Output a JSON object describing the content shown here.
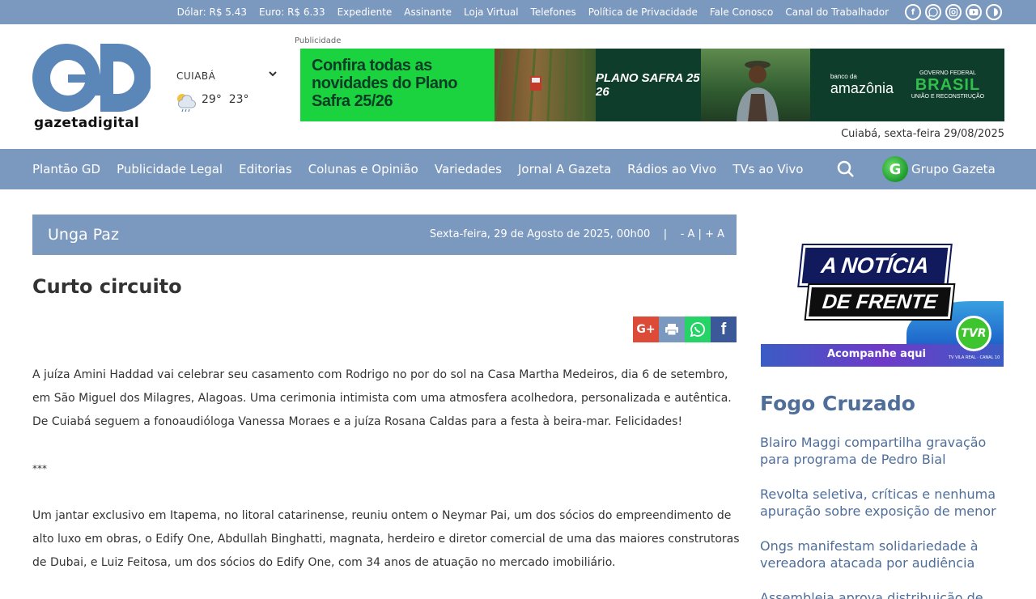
{
  "topbar": {
    "links": [
      "Dólar: R$ 5.43",
      "Euro: R$ 6.33",
      "Expediente",
      "Assinante",
      "Loja Virtual",
      "Telefones",
      "Política de Privacidade",
      "Fale Conosco",
      "Canal do Trabalhador"
    ],
    "social_icons": [
      "facebook-icon",
      "whatsapp-icon",
      "instagram-icon",
      "youtube-icon",
      "contrast-icon"
    ]
  },
  "header": {
    "logo_text": "gazetadigital",
    "weather_city": "CUIABÁ",
    "temp_max": "29°",
    "temp_min": "23°",
    "ad_label": "Publicidade",
    "date_line": "Cuiabá, sexta-feira 29/08/2025"
  },
  "banner": {
    "headline": "Confira todas as novidades do Plano Safra 25/26",
    "badge": "PLANO SAFRA 25 26",
    "bank_small": "banco da",
    "bank": "amazônia",
    "gov_top": "GOVERNO FEDERAL",
    "gov_main": "BRASIL",
    "gov_sub": "UNIÃO E RECONSTRUÇÃO"
  },
  "nav": {
    "items": [
      "Plantão GD",
      "Publicidade Legal",
      "Editorias",
      "Colunas e Opinião",
      "Variedades",
      "Jornal A Gazeta",
      "Rádios ao Vivo",
      "TVs ao Vivo"
    ],
    "grupo": "Grupo Gazeta"
  },
  "column": {
    "name": "Unga Paz",
    "date": "Sexta-feira, 29 de Agosto de 2025, 00h00",
    "font_smaller": "- A",
    "font_larger": "+ A"
  },
  "article": {
    "title": "Curto circuito",
    "paragraphs": [
      "A juíza Amini Haddad vai celebrar seu casamento com Rodrigo no por do sol na Casa Martha Medeiros, dia 6 de setembro, em São Miguel dos Milagres, Alagoas. Uma cerimonia intimista com uma atmosfera acolhedora, personalizada e autêntica. De Cuiabá seguem a fonoaudióloga Vanessa Moraes e a juíza Rosana Caldas para a festa à beira-mar. Felicidades!",
      "***",
      "Um jantar exclusivo em Itapema, no litoral catarinense, reuniu ontem o Neymar Pai, um dos sócios do empreendimento de alto luxo em obras, o Edify One, Abdullah Binghatti, magnata, herdeiro e diretor comercial de uma das maiores construtoras de Dubai, e Luiz Feitosa, um dos sócios do Edify One, com 34 anos de atuação no mercado imobiliário."
    ],
    "share": [
      "G+",
      "print-icon",
      "whatsapp-icon",
      "f"
    ]
  },
  "sidebar": {
    "ad_line1": "A NOTÍCIA",
    "ad_line2": "DE FRENTE",
    "ad_cta": "Acompanhe aqui",
    "ad_logo": "TVR",
    "ad_logo_sub": "TV VILA REAL · CANAL 10",
    "fogo_title": "Fogo Cruzado",
    "fogo_items": [
      "Blairo Maggi compartilha gravação para programa de Pedro Bial",
      "Revolta seletiva, críticas e nenhuma apuração sobre exposição de menor",
      "Ongs manifestam solidariedade à vereadora atacada por audiência",
      "Assembleia aprova distribuição de"
    ]
  },
  "colors": {
    "brand_blue": "#7b98bf",
    "link_blue": "#4f6e9a",
    "gplus": "#dc4a38",
    "print": "#7b98bf",
    "whatsapp": "#25d366",
    "facebook": "#3b5998"
  }
}
